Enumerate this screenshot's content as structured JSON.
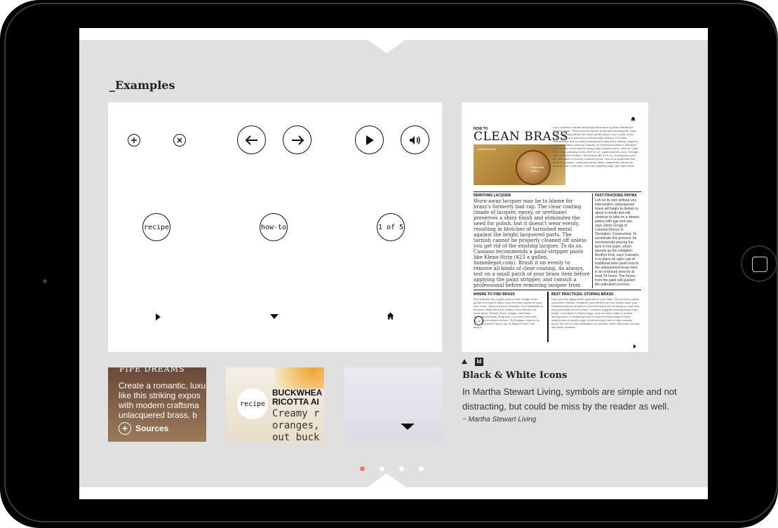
{
  "section_title": "_Examples",
  "icon_sheet": {
    "recipe_label": "recipe",
    "howto_label": "how-to",
    "pager_label": "1 of 5"
  },
  "magazine_page": {
    "kicker": "HOW TO",
    "headline": "CLEAN BRASS",
    "photo_label_left": "polished brass",
    "photo_label_right": "brass with patina",
    "intro": "Don't overlook a brass find simply because it appears blackened beyond repair. \"Removing the tarnish is like discovering gold,\" says Keen. Martha polishes her brass pieces about once a year, every three years, she has them professionally cleaned. For basic maintenance and to make unlacquered brass shine without stripping away the patina, Anthony Cassano of Greenwich Metal in Stamford, Connecticut, recommends using polish-soaked cloths, such as Cape Cod metal-polishing cloths ($20 for 12, capecodpolish.com). Stronger, more abrasive cleaners, like Brasso ($3 for 8 oz., homedepot.com), are best used on heavily oxidized pieces. Test on a small area first, advises Cassano. Lacquered-brass items, meanwhile, should be cleaned with a soft cloth, mild dish-washing soap, and tepid water.",
    "removing_head": "REMOVING LACQUER",
    "removing_body": "Worn-away lacquer may be to blame for brass's formerly bad rap. The clear coating (made of lacquer, epoxy, or urethane) preserves a shiny finish and eliminates the need for polish, but it doesn't wear evenly, resulting in blotches of tarnished metal against the bright lacquered parts. The tarnish cannot be properly cleaned off unless you get rid of the existing lacquer. To do so, Cassano recommends a paint-stripper paste like Klean-Strip ($23 a gallon, homedepot.com). Brush it on evenly to remove all kinds of clear coating. As always, test on a small patch of your brass item before applying the paint stripper, and consult a professional before removing lacquer from any large or valuable piece.",
    "patina_head": "FAST-TRACKING PATINA",
    "patina_body": "Left on its own without any intervention, unlacquered brass will begin to darken in about a month and will continue to take on a deeper patina with age and use, says Jamie Gregg of Colonial Bronze in Torrington, Connecticut. To accelerate this process, he recommends placing the item in hot water, which speeds up the oxidation. Another trick, says Cassano, is to place an open can of traditional latex paint next to the unlacquered-brass item in an enclosed area for at least 24 hours. The fumes from the paint will quicken the patination process.",
    "where_head": "WHERE TO FIND BRASS",
    "where_body": "Flea markets are a great place to nab vintage brass goods, but if you'd rather shop from the comfort of your own home, check out these websites. From hardware to furniture, eBay offers the widest online selection of brass items. Search terms: vintage, raw brass, unlacquered brass. ebay.com. For even more finds, expand your search abroad. Try England, ebay.co.uk. And if you know French, go to eBay's French site, ebay.fr.",
    "pager_small": "1 of 5",
    "best_head": "BEST PRACTICES: STORING BRASS",
    "best_body": "How you view aging brass depends on your taste. One person's patina is another's tarnish. Whatever your preference, you should store your treasured objects properly to prevent them from oxidizing so much that they practically become black. Cassano suggests stowing brass trays, bowls, or tumblers in flannel bags, such as those made to protect sterling silver, or wrapping them in acid-free tissue paper before sealing them in plastic bags. Avoid keeping them in high-humidity spots, and do not use newspaper, he advises, which has acidic ink that will cause oxidation."
  },
  "caption": {
    "app_badge": "Id",
    "title": "Black & White Icons",
    "body": "In Martha Stewart Living, symbols are simple and not distracting, but could be miss by the reader as well.",
    "source": "~ Martha Stewart Living"
  },
  "thumbs": [
    {
      "heading": "PIPE DREAMS",
      "lines": [
        "Create a romantic, luxu",
        "like this striking expos",
        "with modern craftsma",
        "unlacquered brass, b"
      ],
      "sources_label": "Sources"
    },
    {
      "recipe_label": "recipe",
      "heading_1": "BUCKWHEA",
      "heading_2": "RICOTTA AI",
      "lines": [
        "Creamy r",
        "oranges,",
        "out buck"
      ]
    },
    {}
  ],
  "pagination": {
    "count": 4,
    "active": 0
  },
  "colors": {
    "accent_dot": "#f07a6a",
    "panel_gray": "#e0e0e0"
  }
}
